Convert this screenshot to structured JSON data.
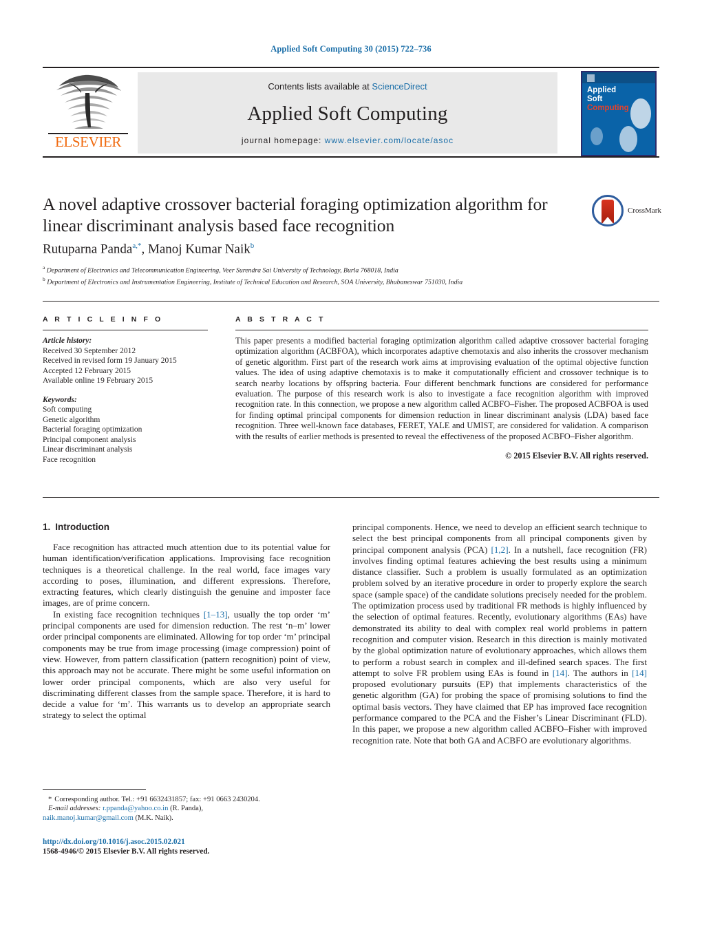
{
  "running_head": "Applied Soft Computing 30 (2015) 722–736",
  "banner": {
    "contents_prefix": "Contents lists available at ",
    "sciencedirect": "ScienceDirect",
    "journal_title": "Applied Soft Computing",
    "homepage_prefix": "journal homepage: ",
    "homepage_url": "www.elsevier.com/locate/asoc",
    "publisher_logo_text": "ELSEVIER",
    "cover": {
      "line1": "Applied",
      "line2": "Soft",
      "line3": "Computing"
    },
    "link_color": "#1a6ea8",
    "cover_color": "#0a63a8"
  },
  "article": {
    "title": "A novel adaptive crossover bacterial foraging optimization algorithm for linear discriminant analysis based face recognition",
    "crossmark_label": "CrossMark",
    "authors": [
      {
        "name": "Rutuparna Panda",
        "marks": "a,*"
      },
      {
        "name": "Manoj Kumar Naik",
        "marks": "b"
      }
    ],
    "authors_line_plain": "Rutuparna Panda, Manoj Kumar Naik",
    "affiliations": [
      {
        "mark": "a",
        "text": "Department of Electronics and Telecommunication Engineering, Veer Surendra Sai University of Technology, Burla 768018, India"
      },
      {
        "mark": "b",
        "text": "Department of Electronics and Instrumentation Engineering, Institute of Technical Education and Research, SOA University, Bhubaneswar 751030, India"
      }
    ]
  },
  "article_info": {
    "heading": "A R T I C L E   I N F O",
    "history_label": "Article history:",
    "history": [
      "Received 30 September 2012",
      "Received in revised form 19 January 2015",
      "Accepted 12 February 2015",
      "Available online 19 February 2015"
    ],
    "keywords_label": "Keywords:",
    "keywords": [
      "Soft computing",
      "Genetic algorithm",
      "Bacterial foraging optimization",
      "Principal component analysis",
      "Linear discriminant analysis",
      "Face recognition"
    ]
  },
  "abstract": {
    "heading": "A B S T R A C T",
    "text": "This paper presents a modified bacterial foraging optimization algorithm called adaptive crossover bacterial foraging optimization algorithm (ACBFOA), which incorporates adaptive chemotaxis and also inherits the crossover mechanism of genetic algorithm. First part of the research work aims at improvising evaluation of the optimal objective function values. The idea of using adaptive chemotaxis is to make it computationally efficient and crossover technique is to search nearby locations by offspring bacteria. Four different benchmark functions are considered for performance evaluation. The purpose of this research work is also to investigate a face recognition algorithm with improved recognition rate. In this connection, we propose a new algorithm called ACBFO–Fisher. The proposed ACBFOA is used for finding optimal principal components for dimension reduction in linear discriminant analysis (LDA) based face recognition. Three well-known face databases, FERET, YALE and UMIST, are considered for validation. A comparison with the results of earlier methods is presented to reveal the effectiveness of the proposed ACBFO–Fisher algorithm.",
    "copyright": "© 2015 Elsevier B.V. All rights reserved."
  },
  "introduction": {
    "section_number": "1.",
    "section_title": "Introduction",
    "paragraph1": "Face recognition has attracted much attention due to its potential value for human identification/verification applications. Improvising face recognition techniques is a theoretical challenge. In the real world, face images vary according to poses, illumination, and different expressions. Therefore, extracting features, which clearly distinguish the genuine and imposter face images, are of prime concern.",
    "paragraph2_part1": "In existing face recognition techniques ",
    "paragraph2_ref1": "[1–13]",
    "paragraph2_part2": ", usually the top order ‘m’ principal components are used for dimension reduction. The rest ‘n–m’ lower order principal components are eliminated. Allowing for top order ‘m’ principal components may be true from image processing (image compression) point of view. However, from pattern classification (pattern recognition) point of view, this approach may not be accurate. There might be some useful information on lower order principal components, which are also very useful for discriminating different classes from the sample space. Therefore, it is hard to decide a value for ‘m’. This warrants us to develop an appropriate search strategy to select the optimal",
    "right_part1": "principal components. Hence, we need to develop an efficient search technique to select the best principal components from all principal components given by principal component analysis (PCA) ",
    "right_ref1": "[1,2]",
    "right_part2": ". In a nutshell, face recognition (FR) involves finding optimal features achieving the best results using a minimum distance classifier. Such a problem is usually formulated as an optimization problem solved by an iterative procedure in order to properly explore the search space (sample space) of the candidate solutions precisely needed for the problem. The optimization process used by traditional FR methods is highly influenced by the selection of optimal features. Recently, evolutionary algorithms (EAs) have demonstrated its ability to deal with complex real world problems in pattern recognition and computer vision. Research in this direction is mainly motivated by the global optimization nature of evolutionary approaches, which allows them to perform a robust search in complex and ill-defined search spaces. The first attempt to solve FR problem using EAs is found in ",
    "right_ref2": "[14]",
    "right_part3": ". The authors in ",
    "right_ref3": "[14]",
    "right_part4": " proposed evolutionary pursuits (EP) that implements characteristics of the genetic algorithm (GA) for probing the space of promising solutions to find the optimal basis vectors. They have claimed that EP has improved face recognition performance compared to the PCA and the Fisher’s Linear Discriminant (FLD). In this paper, we propose a new algorithm called ACBFO–Fisher with improved recognition rate. Note that both GA and ACBFO are evolutionary algorithms."
  },
  "footnote": {
    "star": "*",
    "corresponding": "Corresponding author. Tel.: +91 6632431857; fax: +91 0663 2430204.",
    "email_label": "E-mail addresses:",
    "email1": "r.ppanda@yahoo.co.in",
    "email1_owner": "(R. Panda),",
    "email2": "naik.manoj.kumar@gmail.com",
    "email2_owner": "(M.K. Naik)."
  },
  "footer": {
    "doi": "http://dx.doi.org/10.1016/j.asoc.2015.02.021",
    "issn_line": "1568-4946/© 2015 Elsevier B.V. All rights reserved."
  }
}
